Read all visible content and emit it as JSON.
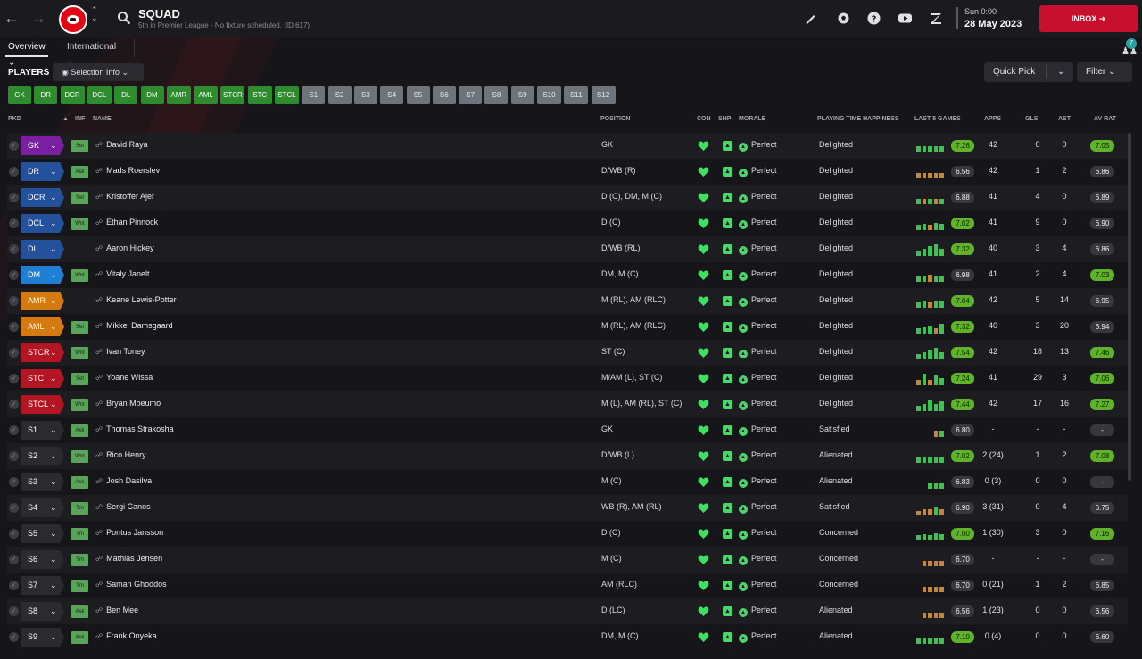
{
  "header": {
    "title": "SQUAD",
    "subtitle": "5th in Premier League - No fixture scheduled. (ID:617)",
    "date_line1": "Sun 0:00",
    "date_line2": "28 May 2023",
    "inbox_label": "INBOX",
    "notif_count": "7"
  },
  "tabs": [
    {
      "label": "Overview ⌄"
    },
    {
      "label": "International ⌄"
    }
  ],
  "players_label": "PLAYERS",
  "selection_info": "Selection Info",
  "quick_pick": "Quick Pick",
  "filter": "Filter",
  "position_buttons": [
    {
      "label": "GK",
      "state": "filled"
    },
    {
      "label": "DR",
      "state": "filled"
    },
    {
      "label": "DCR",
      "state": "filled"
    },
    {
      "label": "DCL",
      "state": "filled"
    },
    {
      "label": "DL",
      "state": "filled"
    },
    {
      "label": "DM",
      "state": "filled"
    },
    {
      "label": "AMR",
      "state": "filled"
    },
    {
      "label": "AML",
      "state": "filled"
    },
    {
      "label": "STCR",
      "state": "filled"
    },
    {
      "label": "STC",
      "state": "filled"
    },
    {
      "label": "STCL",
      "state": "filled"
    },
    {
      "label": "S1",
      "state": "sub"
    },
    {
      "label": "S2",
      "state": "sub"
    },
    {
      "label": "S3",
      "state": "sub"
    },
    {
      "label": "S4",
      "state": "sub"
    },
    {
      "label": "S5",
      "state": "sub"
    },
    {
      "label": "S6",
      "state": "sub"
    },
    {
      "label": "S7",
      "state": "sub"
    },
    {
      "label": "S8",
      "state": "sub"
    },
    {
      "label": "S9",
      "state": "sub"
    },
    {
      "label": "S10",
      "state": "sub"
    },
    {
      "label": "S11",
      "state": "sub"
    },
    {
      "label": "S12",
      "state": "sub"
    }
  ],
  "columns": {
    "pkd": "PKD",
    "sort": "▲",
    "inf": "INF",
    "name": "NAME",
    "position": "POSITION",
    "con": "CON",
    "shp": "SHP",
    "morale": "MORALE",
    "pth": "PLAYING TIME HAPPINESS",
    "last5": "LAST 5 GAMES",
    "apps": "APPS",
    "gls": "GLS",
    "ast": "AST",
    "avrat": "AV RAT"
  },
  "players": [
    {
      "pkd": "GK",
      "pkd_color": "#7a1fa2",
      "inf": "Set",
      "name": "David Raya",
      "position": "GK",
      "morale": "Perfect",
      "pth": "Delighted",
      "form": [
        0.5,
        0.5,
        0.5,
        0.5,
        0.5
      ],
      "form_color": [
        "#3ec150",
        "#3ec150",
        "#3ec150",
        "#3ec150",
        "#3ec150"
      ],
      "last_rating": "7.26",
      "last_hi": true,
      "apps": "42",
      "gls": "0",
      "ast": "0",
      "avrat": "7.05",
      "av_hi": true
    },
    {
      "pkd": "DR",
      "pkd_color": "#23519c",
      "inf": "Ask",
      "name": "Mads Roerslev",
      "position": "D/WB (R)",
      "morale": "Perfect",
      "pth": "Delighted",
      "form": [
        0.45,
        0.45,
        0.45,
        0.45,
        0.45
      ],
      "form_color": [
        "#c3873a",
        "#c3873a",
        "#c3873a",
        "#c3873a",
        "#c3873a"
      ],
      "last_rating": "6.56",
      "last_hi": false,
      "apps": "42",
      "gls": "1",
      "ast": "2",
      "avrat": "6.86",
      "av_hi": false
    },
    {
      "pkd": "DCR",
      "pkd_color": "#23519c",
      "inf": "Set",
      "name": "Kristoffer Ajer",
      "position": "D (C), DM, M (C)",
      "morale": "Perfect",
      "pth": "Delighted",
      "form": [
        0.45,
        0.45,
        0.45,
        0.45,
        0.45
      ],
      "form_color": [
        "#3ec150",
        "#c3873a",
        "#3ec150",
        "#c3873a",
        "#3ec150"
      ],
      "last_rating": "6.88",
      "last_hi": false,
      "apps": "41",
      "gls": "4",
      "ast": "0",
      "avrat": "6.89",
      "av_hi": false
    },
    {
      "pkd": "DCL",
      "pkd_color": "#23519c",
      "inf": "Wnt",
      "name": "Ethan Pinnock",
      "position": "D (C)",
      "morale": "Perfect",
      "pth": "Delighted",
      "form": [
        0.45,
        0.5,
        0.45,
        0.6,
        0.5
      ],
      "form_color": [
        "#3ec150",
        "#3ec150",
        "#c3873a",
        "#3ec150",
        "#3ec150"
      ],
      "last_rating": "7.02",
      "last_hi": true,
      "apps": "41",
      "gls": "9",
      "ast": "0",
      "avrat": "6.90",
      "av_hi": false
    },
    {
      "pkd": "DL",
      "pkd_color": "#23519c",
      "inf": "",
      "name": "Aaron Hickey",
      "position": "D/WB (RL)",
      "morale": "Perfect",
      "pth": "Delighted",
      "form": [
        0.45,
        0.6,
        0.75,
        0.9,
        0.6
      ],
      "form_color": [
        "#3ec150",
        "#3ec150",
        "#3ec150",
        "#3ec150",
        "#3ec150"
      ],
      "last_rating": "7.32",
      "last_hi": true,
      "apps": "40",
      "gls": "3",
      "ast": "4",
      "avrat": "6.86",
      "av_hi": false
    },
    {
      "pkd": "DM",
      "pkd_color": "#1f7fd4",
      "inf": "Wnt",
      "name": "Vitaly Janelt",
      "position": "DM, M (C)",
      "morale": "Perfect",
      "pth": "Delighted",
      "form": [
        0.45,
        0.45,
        0.6,
        0.45,
        0.45
      ],
      "form_color": [
        "#3ec150",
        "#3ec150",
        "#c3873a",
        "#3ec150",
        "#3ec150"
      ],
      "last_rating": "6.98",
      "last_hi": false,
      "apps": "41",
      "gls": "2",
      "ast": "4",
      "avrat": "7.03",
      "av_hi": true
    },
    {
      "pkd": "AMR",
      "pkd_color": "#d47a0f",
      "inf": "",
      "name": "Keane Lewis-Potter",
      "position": "M (RL), AM (RLC)",
      "morale": "Perfect",
      "pth": "Delighted",
      "form": [
        0.45,
        0.55,
        0.45,
        0.6,
        0.5
      ],
      "form_color": [
        "#3ec150",
        "#3ec150",
        "#c3873a",
        "#3ec150",
        "#3ec150"
      ],
      "last_rating": "7.04",
      "last_hi": true,
      "apps": "42",
      "gls": "5",
      "ast": "14",
      "avrat": "6.95",
      "av_hi": false
    },
    {
      "pkd": "AML",
      "pkd_color": "#d47a0f",
      "inf": "Set",
      "name": "Mikkel Damsgaard",
      "position": "M (RL), AM (RLC)",
      "morale": "Perfect",
      "pth": "Delighted",
      "form": [
        0.45,
        0.5,
        0.6,
        0.45,
        0.75
      ],
      "form_color": [
        "#3ec150",
        "#3ec150",
        "#3ec150",
        "#c3873a",
        "#3ec150"
      ],
      "last_rating": "7.32",
      "last_hi": true,
      "apps": "40",
      "gls": "3",
      "ast": "20",
      "avrat": "6.94",
      "av_hi": false
    },
    {
      "pkd": "STCR",
      "pkd_color": "#b31622",
      "inf": "Wnt",
      "name": "Ivan Toney",
      "position": "ST (C)",
      "morale": "Perfect",
      "pth": "Delighted",
      "form": [
        0.45,
        0.6,
        0.75,
        0.9,
        0.6
      ],
      "form_color": [
        "#3ec150",
        "#3ec150",
        "#3ec150",
        "#3ec150",
        "#3ec150"
      ],
      "last_rating": "7.54",
      "last_hi": true,
      "apps": "42",
      "gls": "18",
      "ast": "13",
      "avrat": "7.46",
      "av_hi": true
    },
    {
      "pkd": "STC",
      "pkd_color": "#b31622",
      "inf": "Set",
      "name": "Yoane Wissa",
      "position": "M/AM (L), ST (C)",
      "morale": "Perfect",
      "pth": "Delighted",
      "form": [
        0.45,
        0.9,
        0.45,
        0.75,
        0.6
      ],
      "form_color": [
        "#c3873a",
        "#3ec150",
        "#c3873a",
        "#3ec150",
        "#3ec150"
      ],
      "last_rating": "7.24",
      "last_hi": true,
      "apps": "41",
      "gls": "29",
      "ast": "3",
      "avrat": "7.06",
      "av_hi": true
    },
    {
      "pkd": "STCL",
      "pkd_color": "#b31622",
      "inf": "Wnt",
      "name": "Bryan Mbeumo",
      "position": "M (L), AM (RL), ST (C)",
      "morale": "Perfect",
      "pth": "Delighted",
      "form": [
        0.45,
        0.6,
        0.9,
        0.6,
        0.75
      ],
      "form_color": [
        "#3ec150",
        "#3ec150",
        "#3ec150",
        "#3ec150",
        "#3ec150"
      ],
      "last_rating": "7.44",
      "last_hi": true,
      "apps": "42",
      "gls": "17",
      "ast": "16",
      "avrat": "7.27",
      "av_hi": true
    },
    {
      "pkd": "S1",
      "pkd_color": "#2a2a30",
      "inf": "Ask",
      "name": "Thomas Strakosha",
      "position": "GK",
      "morale": "Perfect",
      "pth": "Satisfied",
      "form": [
        0,
        0,
        0,
        0.5,
        0.5
      ],
      "form_color": [
        "#3ec150",
        "#3ec150",
        "#3ec150",
        "#c3873a",
        "#3ec150"
      ],
      "last_rating": "6.80",
      "last_hi": false,
      "apps": "-",
      "gls": "-",
      "ast": "-",
      "avrat": "-",
      "av_hi": false
    },
    {
      "pkd": "S2",
      "pkd_color": "#2a2a30",
      "inf": "Wnt",
      "name": "Rico Henry",
      "position": "D/WB (L)",
      "morale": "Perfect",
      "pth": "Alienated",
      "form": [
        0.45,
        0.45,
        0.45,
        0.45,
        0.45
      ],
      "form_color": [
        "#3ec150",
        "#3ec150",
        "#3ec150",
        "#3ec150",
        "#3ec150"
      ],
      "last_rating": "7.02",
      "last_hi": true,
      "apps": "2 (24)",
      "gls": "1",
      "ast": "2",
      "avrat": "7.08",
      "av_hi": true
    },
    {
      "pkd": "S3",
      "pkd_color": "#2a2a30",
      "inf": "Ask",
      "name": "Josh Dasilva",
      "position": "M (C)",
      "morale": "Perfect",
      "pth": "Alienated",
      "form": [
        0,
        0,
        0.45,
        0.45,
        0.45
      ],
      "form_color": [
        "#3ec150",
        "#3ec150",
        "#3ec150",
        "#3ec150",
        "#3ec150"
      ],
      "last_rating": "6.83",
      "last_hi": false,
      "apps": "0 (3)",
      "gls": "0",
      "ast": "0",
      "avrat": "-",
      "av_hi": false
    },
    {
      "pkd": "S4",
      "pkd_color": "#2a2a30",
      "inf": "Tm",
      "name": "Sergi Canos",
      "position": "WB (R), AM (RL)",
      "morale": "Perfect",
      "pth": "Satisfied",
      "form": [
        0.3,
        0.45,
        0.45,
        0.6,
        0.45
      ],
      "form_color": [
        "#c3873a",
        "#c3873a",
        "#c3873a",
        "#3ec150",
        "#c3873a"
      ],
      "last_rating": "6.90",
      "last_hi": false,
      "apps": "3 (31)",
      "gls": "0",
      "ast": "4",
      "avrat": "6.75",
      "av_hi": false
    },
    {
      "pkd": "S5",
      "pkd_color": "#2a2a30",
      "inf": "Tm",
      "name": "Pontus Jansson",
      "position": "D (C)",
      "morale": "Perfect",
      "pth": "Concerned",
      "form": [
        0.45,
        0.5,
        0.45,
        0.55,
        0.5
      ],
      "form_color": [
        "#3ec150",
        "#3ec150",
        "#3ec150",
        "#3ec150",
        "#3ec150"
      ],
      "last_rating": "7.00",
      "last_hi": true,
      "apps": "1 (30)",
      "gls": "3",
      "ast": "0",
      "avrat": "7.16",
      "av_hi": true
    },
    {
      "pkd": "S6",
      "pkd_color": "#2a2a30",
      "inf": "Tm",
      "name": "Mathias Jensen",
      "position": "M (C)",
      "morale": "Perfect",
      "pth": "Concerned",
      "form": [
        0,
        0.45,
        0.45,
        0.45,
        0.45
      ],
      "form_color": [
        "#c3873a",
        "#c3873a",
        "#c3873a",
        "#c3873a",
        "#c3873a"
      ],
      "last_rating": "6.70",
      "last_hi": false,
      "apps": "-",
      "gls": "-",
      "ast": "-",
      "avrat": "-",
      "av_hi": false
    },
    {
      "pkd": "S7",
      "pkd_color": "#2a2a30",
      "inf": "Tm",
      "name": "Saman Ghoddos",
      "position": "AM (RLC)",
      "morale": "Perfect",
      "pth": "Concerned",
      "form": [
        0,
        0.45,
        0.45,
        0.45,
        0.45
      ],
      "form_color": [
        "#c3873a",
        "#c3873a",
        "#c3873a",
        "#c3873a",
        "#c3873a"
      ],
      "last_rating": "6.70",
      "last_hi": false,
      "apps": "0 (21)",
      "gls": "1",
      "ast": "2",
      "avrat": "6.85",
      "av_hi": false
    },
    {
      "pkd": "S8",
      "pkd_color": "#2a2a30",
      "inf": "Ask",
      "name": "Ben Mee",
      "position": "D (LC)",
      "morale": "Perfect",
      "pth": "Alienated",
      "form": [
        0,
        0.45,
        0.45,
        0.45,
        0.45
      ],
      "form_color": [
        "#c3873a",
        "#c3873a",
        "#c3873a",
        "#c3873a",
        "#c3873a"
      ],
      "last_rating": "6.56",
      "last_hi": false,
      "apps": "1 (23)",
      "gls": "0",
      "ast": "0",
      "avrat": "6.56",
      "av_hi": false
    },
    {
      "pkd": "S9",
      "pkd_color": "#2a2a30",
      "inf": "Ask",
      "name": "Frank Onyeka",
      "position": "DM, M (C)",
      "morale": "Perfect",
      "pth": "Alienated",
      "form": [
        0.45,
        0.45,
        0.45,
        0.45,
        0.45
      ],
      "form_color": [
        "#3ec150",
        "#3ec150",
        "#3ec150",
        "#3ec150",
        "#3ec150"
      ],
      "last_rating": "7.10",
      "last_hi": true,
      "apps": "0 (4)",
      "gls": "0",
      "ast": "0",
      "avrat": "6.60",
      "av_hi": false
    }
  ]
}
